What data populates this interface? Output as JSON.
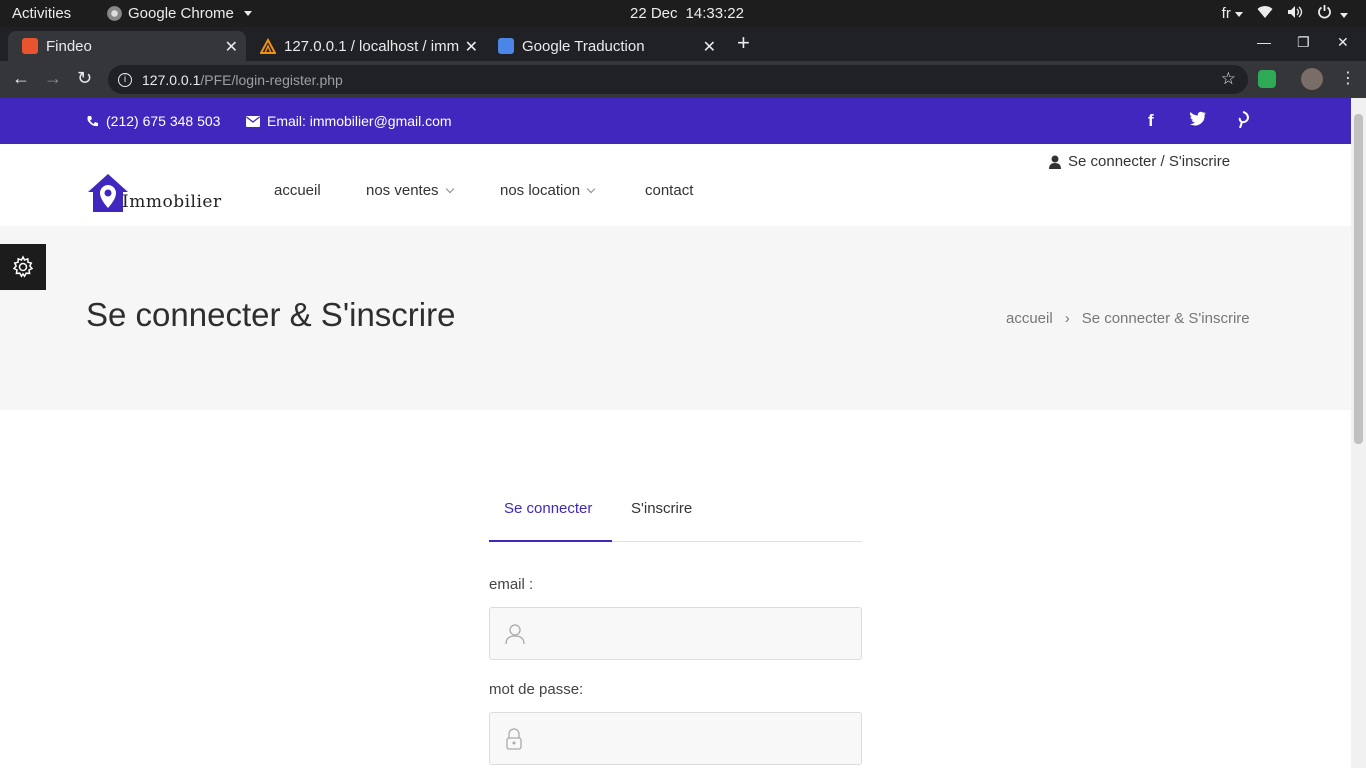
{
  "system_bar": {
    "activities": "Activities",
    "app_name": "Google Chrome",
    "date": "22 Dec",
    "time": "14:33:22",
    "keyboard_layout": "fr"
  },
  "browser": {
    "tabs": [
      {
        "title": "Findeo",
        "active": true
      },
      {
        "title": "127.0.0.1 / localhost / imm",
        "active": false
      },
      {
        "title": "Google Traduction",
        "active": false
      }
    ],
    "url_host": "127.0.0.1",
    "url_path": "/PFE/login-register.php"
  },
  "topbar": {
    "phone": "(212) 675 348 503",
    "email": "Email: immobilier@gmail.com"
  },
  "header": {
    "logo_text": "Immobilier",
    "nav": [
      "accueil",
      "nos ventes",
      "nos location",
      "contact"
    ],
    "login_link": "Se connecter / S'inscrire"
  },
  "hero": {
    "title": "Se connecter & S'inscrire",
    "breadcrumb_home": "accueil",
    "breadcrumb_current": "Se connecter & S'inscrire"
  },
  "form": {
    "tab_login": "Se connecter",
    "tab_register": "S'inscrire",
    "email_label": "email :",
    "password_label": "mot de passe:"
  },
  "colors": {
    "brand": "#4127bd",
    "hero_bg": "#f6f6f6"
  }
}
